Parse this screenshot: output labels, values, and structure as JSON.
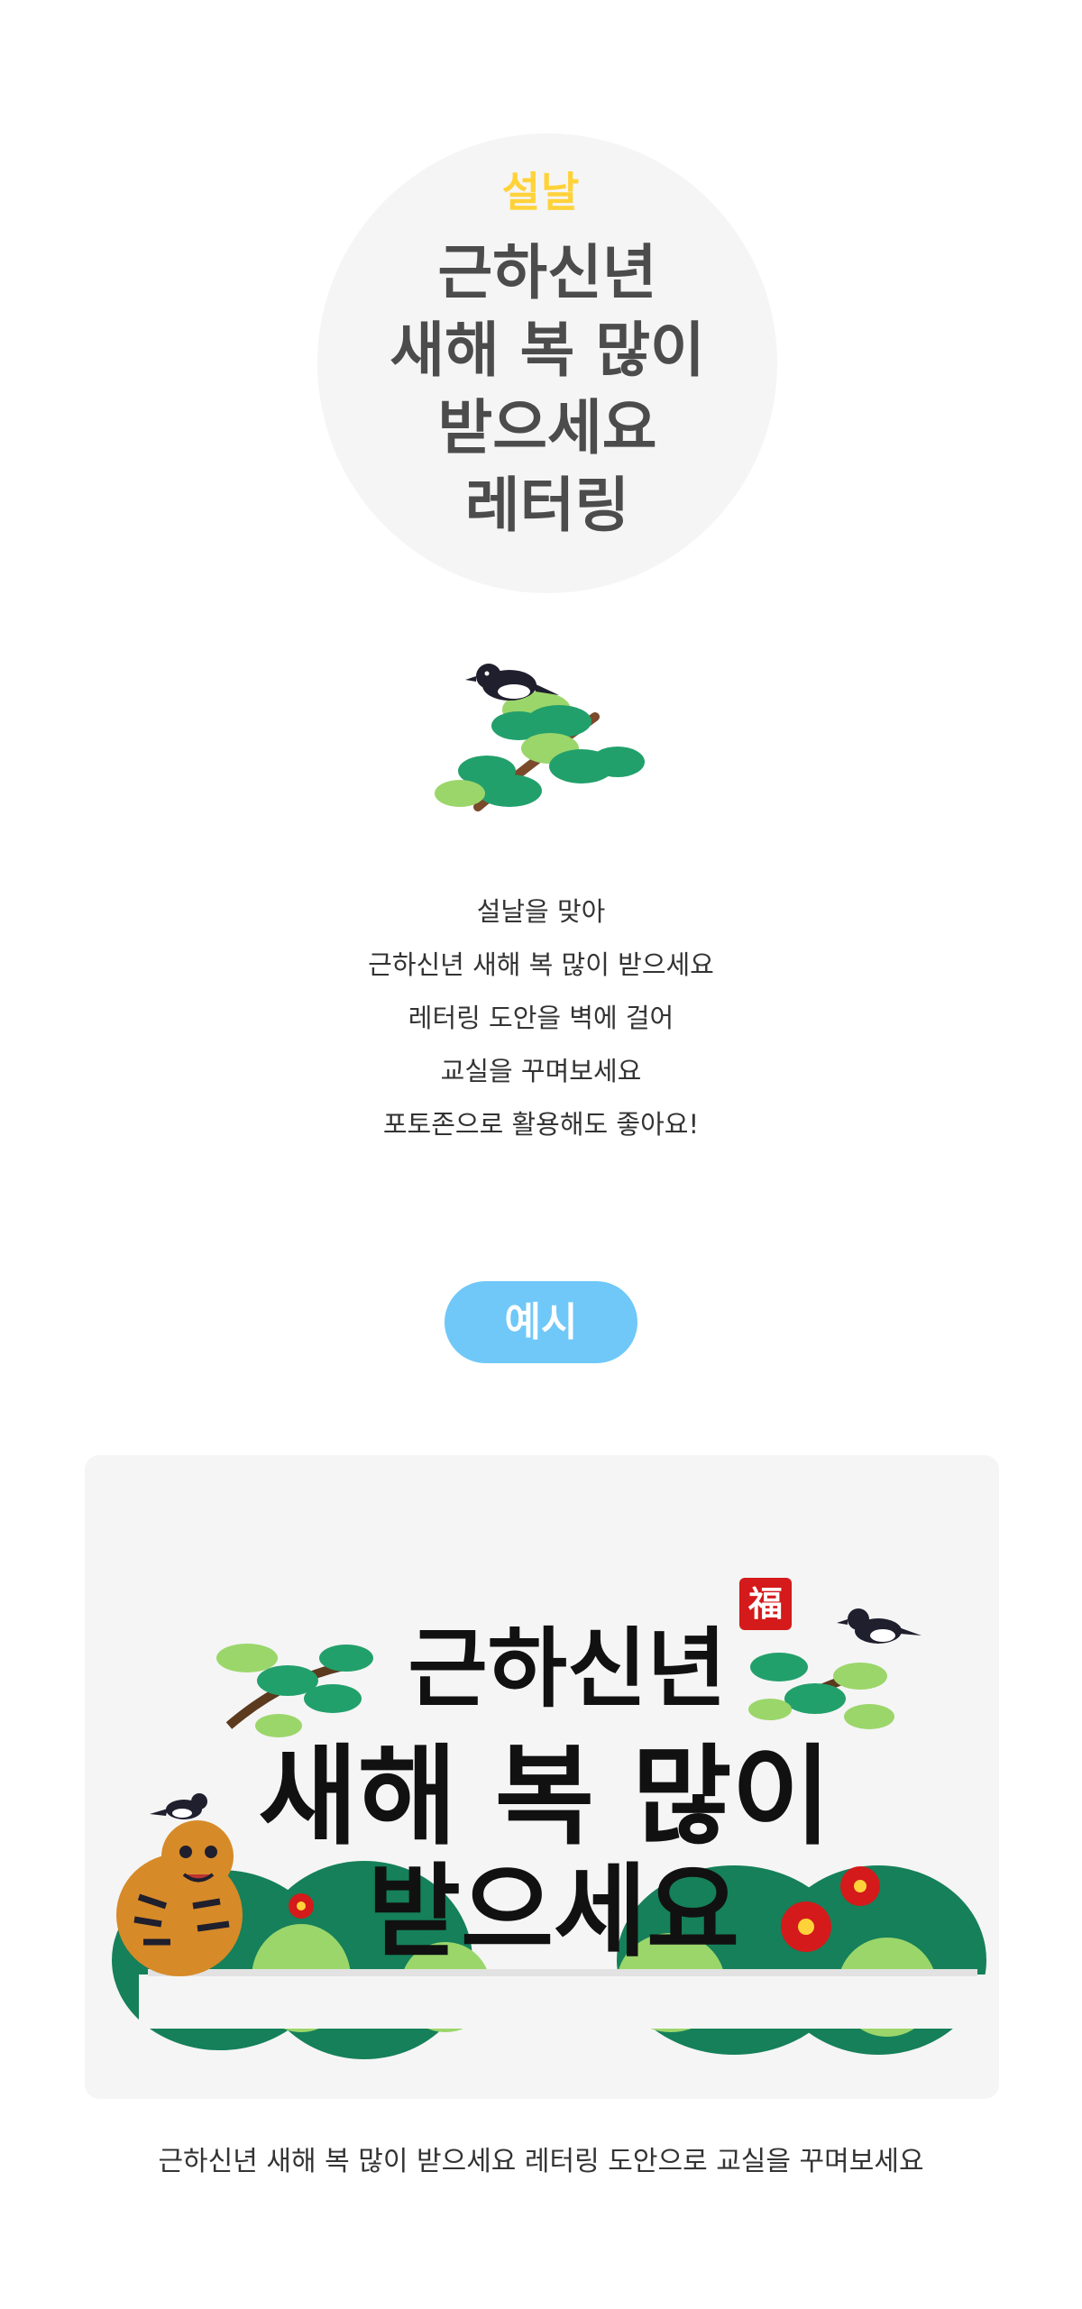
{
  "hero": {
    "tag": "설날",
    "title_lines": [
      "근하신년",
      "새해 복 많이",
      "받으세요",
      "레터링"
    ]
  },
  "intro": {
    "lines": [
      "설날을 맞아",
      "근하신년 새해 복 많이 받으세요",
      "레터링 도안을 벽에 걸어",
      "교실을 꾸며보세요",
      "포토존으로 활용해도 좋아요!"
    ]
  },
  "example": {
    "label": "예시",
    "banner": {
      "line1": "근하신년",
      "line2": "새해 복 많이",
      "line3": "받으세요",
      "seal": "福"
    },
    "caption": "근하신년 새해 복 많이 받으세요 레터링 도안으로 교실을 꾸며보세요"
  },
  "colors": {
    "accent_yellow": "#ffd23a",
    "pill_blue": "#6fc8f8",
    "pine_green": "#22a06b",
    "hill_dark": "#15805a",
    "hill_light": "#9bd66a",
    "seal_red": "#d41a1a"
  },
  "icons": [
    "magpie-icon",
    "pine-tree-icon",
    "tiger-icon",
    "camellia-icon"
  ]
}
